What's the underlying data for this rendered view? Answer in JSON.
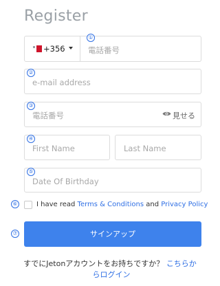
{
  "header": {
    "title": "Register"
  },
  "badges": [
    "①",
    "②",
    "③",
    "④",
    "⑤",
    "⑥",
    "⑦"
  ],
  "phone": {
    "country_code": "+356",
    "flag_icon": "malta-flag-icon",
    "placeholder": "電話番号"
  },
  "email": {
    "placeholder": "e-mail address"
  },
  "password": {
    "placeholder": "電話番号",
    "show_label": "見せる",
    "show_icon": "eye-icon"
  },
  "name": {
    "first_placeholder": "First Name",
    "last_placeholder": "Last Name"
  },
  "birthday": {
    "placeholder": "Date Of Birthday"
  },
  "agreement": {
    "prefix": "I have read ",
    "terms": "Terms & Conditions",
    "and": " and ",
    "privacy": "Privacy Policy"
  },
  "signup_button": "サインアップ",
  "footer": {
    "text": "すでにJetonアカウントをお持ちですか？",
    "link_line1": "こちらか",
    "link_line2": "らログイン"
  },
  "colors": {
    "accent": "#3e82ec",
    "link": "#2f6fe4",
    "border": "#dcdcdc",
    "placeholder": "#a8a8a8"
  }
}
